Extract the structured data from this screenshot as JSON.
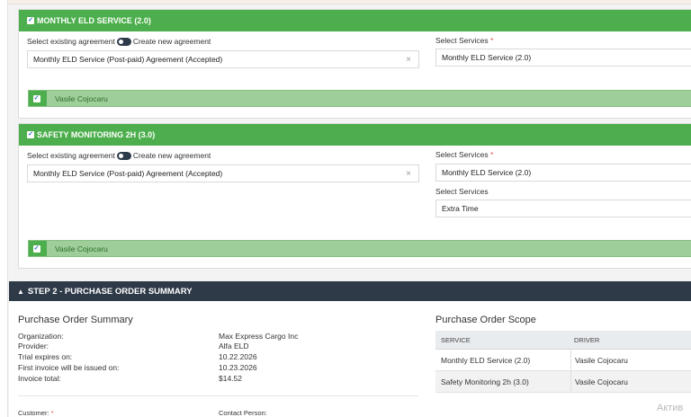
{
  "services": [
    {
      "header": "MONTHLY ELD SERVICE (2.0)",
      "toggle_left": "Select existing agreement",
      "toggle_right": "Create new agreement",
      "agreement": "Monthly ELD Service (Post-paid) Agreement (Accepted)",
      "select_services_label": "Select Services",
      "select_services_required": "*",
      "selected_service": "Monthly ELD Service (2.0)",
      "driver": "Vasile Cojocaru"
    },
    {
      "header": "SAFETY MONITORING 2H (3.0)",
      "toggle_left": "Select existing agreement",
      "toggle_right": "Create new agreement",
      "agreement": "Monthly ELD Service (Post-paid) Agreement (Accepted)",
      "select_services_label": "Select Services",
      "select_services_required": "*",
      "selected_service": "Monthly ELD Service (2.0)",
      "extra_services_label": "Select Services",
      "extra_service": "Extra Time",
      "driver": "Vasile Cojocaru"
    }
  ],
  "step2": {
    "title": "STEP 2 - PURCHASE ORDER SUMMARY"
  },
  "summary": {
    "title": "Purchase Order Summary",
    "rows": [
      {
        "key": "Organization:",
        "value": "Max Express Cargo Inc"
      },
      {
        "key": "Provider:",
        "value": "Alfa ELD"
      },
      {
        "key": "Trial expires on:",
        "value": "10.22.2026"
      },
      {
        "key": "First invoice will be issued on:",
        "value": "10.23.2026"
      },
      {
        "key": "Invoice total:",
        "value": "$14.52"
      }
    ],
    "customer_label": "Customer:",
    "customer_required": "*",
    "contact_label": "Contact Person:"
  },
  "scope": {
    "title": "Purchase Order Scope",
    "columns": [
      "SERVICE",
      "DRIVER"
    ],
    "rows": [
      {
        "service": "Monthly ELD Service (2.0)",
        "driver": "Vasile Cojocaru"
      },
      {
        "service": "Safety Monitoring 2h (3.0)",
        "driver": "Vasile Cojocaru"
      }
    ]
  },
  "watermark": "Актив",
  "colors": {
    "service_header": "#4cae4c",
    "driver_bar": "#9ecf9a",
    "step_bar": "#2e3a48",
    "required": "#d9534f"
  },
  "icons": {
    "checkbox": "check-icon",
    "clear": "close-icon",
    "caret": "chevron-up-icon"
  }
}
